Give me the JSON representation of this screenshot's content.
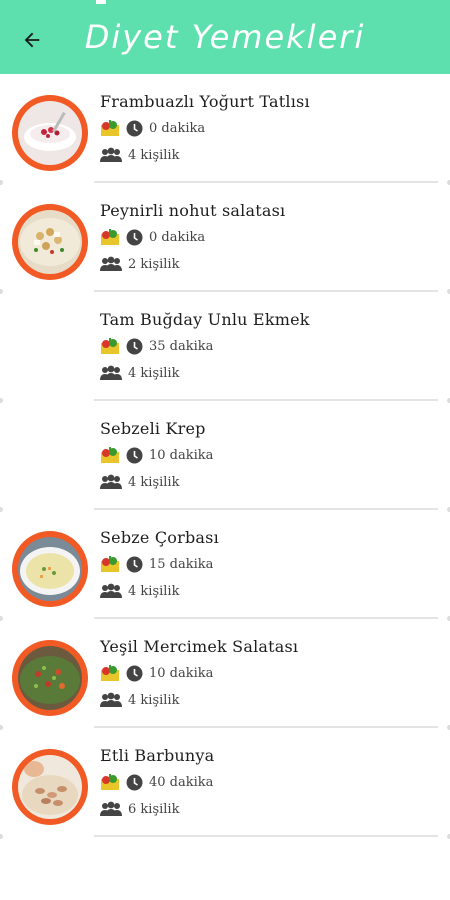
{
  "header": {
    "title": "Diyet Yemekleri",
    "back_icon": "arrow-left-icon",
    "bg_color": "#5ee0ae"
  },
  "recipes": [
    {
      "name": "Frambuazlı Yoğurt Tatlısı",
      "time": "0 dakika",
      "servings": "4 kişilik",
      "has_image": true
    },
    {
      "name": "Peynirli nohut salatası",
      "time": "0 dakika",
      "servings": "2 kişilik",
      "has_image": true
    },
    {
      "name": "Tam Buğday Unlu Ekmek",
      "time": "35 dakika",
      "servings": "4 kişilik",
      "has_image": false
    },
    {
      "name": "Sebzeli Krep",
      "time": "10 dakika",
      "servings": "4 kişilik",
      "has_image": false
    },
    {
      "name": "Sebze Çorbası",
      "time": "15 dakika",
      "servings": "4 kişilik",
      "has_image": true
    },
    {
      "name": "Yeşil Mercimek Salatası",
      "time": "10 dakika",
      "servings": "4 kişilik",
      "has_image": true
    },
    {
      "name": "Etli Barbunya",
      "time": "40 dakika",
      "servings": "6 kişilik",
      "has_image": true
    }
  ],
  "icons": {
    "category": "vegetables-icon",
    "time": "clock-icon",
    "servings": "people-icon"
  },
  "accent_color": "#f15a24"
}
